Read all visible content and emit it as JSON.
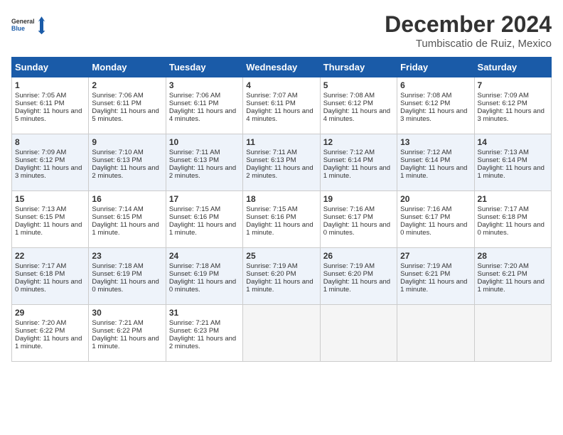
{
  "logo": {
    "line1": "General",
    "line2": "Blue"
  },
  "title": "December 2024",
  "location": "Tumbiscatio de Ruiz, Mexico",
  "days_of_week": [
    "Sunday",
    "Monday",
    "Tuesday",
    "Wednesday",
    "Thursday",
    "Friday",
    "Saturday"
  ],
  "weeks": [
    [
      {
        "day": 1,
        "sunrise": "7:05 AM",
        "sunset": "6:11 PM",
        "daylight": "11 hours and 5 minutes."
      },
      {
        "day": 2,
        "sunrise": "7:06 AM",
        "sunset": "6:11 PM",
        "daylight": "11 hours and 5 minutes."
      },
      {
        "day": 3,
        "sunrise": "7:06 AM",
        "sunset": "6:11 PM",
        "daylight": "11 hours and 4 minutes."
      },
      {
        "day": 4,
        "sunrise": "7:07 AM",
        "sunset": "6:11 PM",
        "daylight": "11 hours and 4 minutes."
      },
      {
        "day": 5,
        "sunrise": "7:08 AM",
        "sunset": "6:12 PM",
        "daylight": "11 hours and 4 minutes."
      },
      {
        "day": 6,
        "sunrise": "7:08 AM",
        "sunset": "6:12 PM",
        "daylight": "11 hours and 3 minutes."
      },
      {
        "day": 7,
        "sunrise": "7:09 AM",
        "sunset": "6:12 PM",
        "daylight": "11 hours and 3 minutes."
      }
    ],
    [
      {
        "day": 8,
        "sunrise": "7:09 AM",
        "sunset": "6:12 PM",
        "daylight": "11 hours and 3 minutes."
      },
      {
        "day": 9,
        "sunrise": "7:10 AM",
        "sunset": "6:13 PM",
        "daylight": "11 hours and 2 minutes."
      },
      {
        "day": 10,
        "sunrise": "7:11 AM",
        "sunset": "6:13 PM",
        "daylight": "11 hours and 2 minutes."
      },
      {
        "day": 11,
        "sunrise": "7:11 AM",
        "sunset": "6:13 PM",
        "daylight": "11 hours and 2 minutes."
      },
      {
        "day": 12,
        "sunrise": "7:12 AM",
        "sunset": "6:14 PM",
        "daylight": "11 hours and 1 minute."
      },
      {
        "day": 13,
        "sunrise": "7:12 AM",
        "sunset": "6:14 PM",
        "daylight": "11 hours and 1 minute."
      },
      {
        "day": 14,
        "sunrise": "7:13 AM",
        "sunset": "6:14 PM",
        "daylight": "11 hours and 1 minute."
      }
    ],
    [
      {
        "day": 15,
        "sunrise": "7:13 AM",
        "sunset": "6:15 PM",
        "daylight": "11 hours and 1 minute."
      },
      {
        "day": 16,
        "sunrise": "7:14 AM",
        "sunset": "6:15 PM",
        "daylight": "11 hours and 1 minute."
      },
      {
        "day": 17,
        "sunrise": "7:15 AM",
        "sunset": "6:16 PM",
        "daylight": "11 hours and 1 minute."
      },
      {
        "day": 18,
        "sunrise": "7:15 AM",
        "sunset": "6:16 PM",
        "daylight": "11 hours and 1 minute."
      },
      {
        "day": 19,
        "sunrise": "7:16 AM",
        "sunset": "6:17 PM",
        "daylight": "11 hours and 0 minutes."
      },
      {
        "day": 20,
        "sunrise": "7:16 AM",
        "sunset": "6:17 PM",
        "daylight": "11 hours and 0 minutes."
      },
      {
        "day": 21,
        "sunrise": "7:17 AM",
        "sunset": "6:18 PM",
        "daylight": "11 hours and 0 minutes."
      }
    ],
    [
      {
        "day": 22,
        "sunrise": "7:17 AM",
        "sunset": "6:18 PM",
        "daylight": "11 hours and 0 minutes."
      },
      {
        "day": 23,
        "sunrise": "7:18 AM",
        "sunset": "6:19 PM",
        "daylight": "11 hours and 0 minutes."
      },
      {
        "day": 24,
        "sunrise": "7:18 AM",
        "sunset": "6:19 PM",
        "daylight": "11 hours and 0 minutes."
      },
      {
        "day": 25,
        "sunrise": "7:19 AM",
        "sunset": "6:20 PM",
        "daylight": "11 hours and 1 minute."
      },
      {
        "day": 26,
        "sunrise": "7:19 AM",
        "sunset": "6:20 PM",
        "daylight": "11 hours and 1 minute."
      },
      {
        "day": 27,
        "sunrise": "7:19 AM",
        "sunset": "6:21 PM",
        "daylight": "11 hours and 1 minute."
      },
      {
        "day": 28,
        "sunrise": "7:20 AM",
        "sunset": "6:21 PM",
        "daylight": "11 hours and 1 minute."
      }
    ],
    [
      {
        "day": 29,
        "sunrise": "7:20 AM",
        "sunset": "6:22 PM",
        "daylight": "11 hours and 1 minute."
      },
      {
        "day": 30,
        "sunrise": "7:21 AM",
        "sunset": "6:22 PM",
        "daylight": "11 hours and 1 minute."
      },
      {
        "day": 31,
        "sunrise": "7:21 AM",
        "sunset": "6:23 PM",
        "daylight": "11 hours and 2 minutes."
      },
      null,
      null,
      null,
      null
    ]
  ]
}
